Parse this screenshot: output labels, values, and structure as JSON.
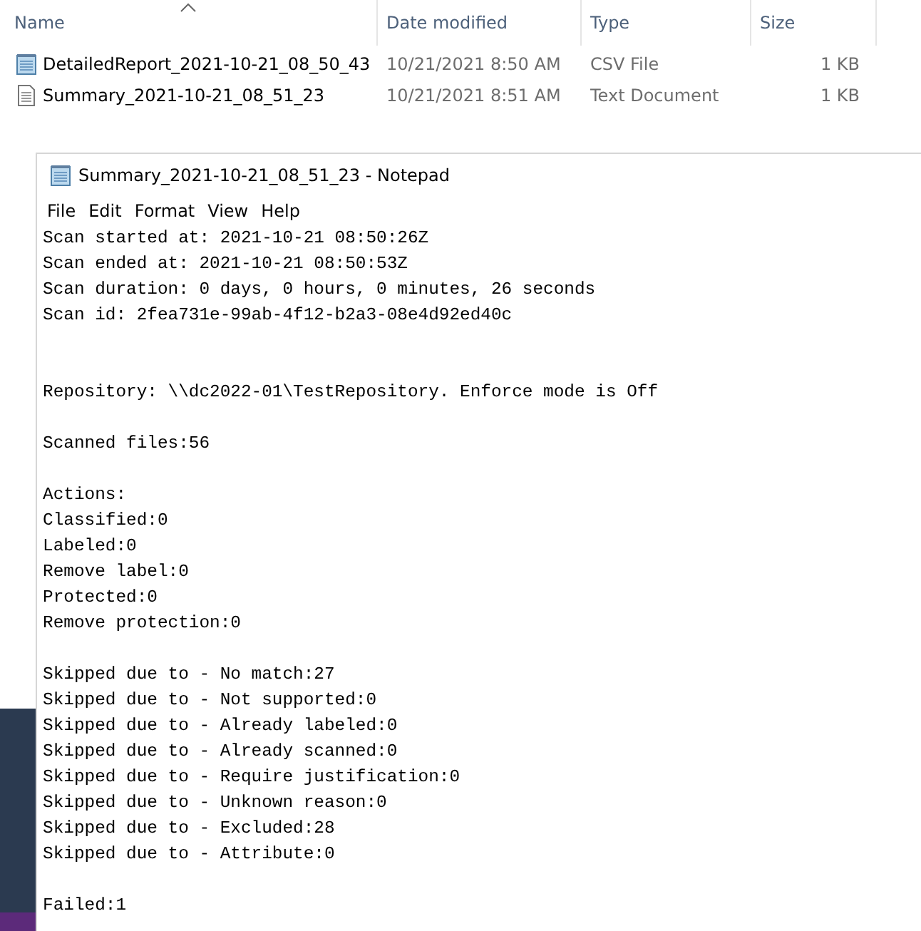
{
  "explorer": {
    "columns": [
      {
        "label": "Name",
        "sorted": true
      },
      {
        "label": "Date modified",
        "sorted": false
      },
      {
        "label": "Type",
        "sorted": false
      },
      {
        "label": "Size",
        "sorted": false
      }
    ],
    "files": [
      {
        "name": "DetailedReport_2021-10-21_08_50_43",
        "date": "10/21/2021 8:50 AM",
        "type": "CSV File",
        "size": "1 KB",
        "kind": "csv"
      },
      {
        "name": "Summary_2021-10-21_08_51_23",
        "date": "10/21/2021 8:51 AM",
        "type": "Text Document",
        "size": "1 KB",
        "kind": "text"
      }
    ]
  },
  "notepad": {
    "title": "Summary_2021-10-21_08_51_23 - Notepad",
    "menu": [
      "File",
      "Edit",
      "Format",
      "View",
      "Help"
    ],
    "paragraphs": [
      [
        "Scan started at: 2021-10-21 08:50:26Z",
        "Scan ended at: 2021-10-21 08:50:53Z",
        "Scan duration: 0 days, 0 hours, 0 minutes, 26 seconds",
        "Scan id: 2fea731e-99ab-4f12-b2a3-08e4d92ed40c"
      ],
      [
        "Repository: \\\\dc2022-01\\TestRepository. Enforce mode is Off"
      ],
      [
        "Scanned files:56"
      ],
      [
        "Actions:",
        "Classified:0",
        "Labeled:0",
        "Remove label:0",
        "Protected:0",
        "Remove protection:0"
      ],
      [
        "Skipped due to - No match:27",
        "Skipped due to - Not supported:0",
        "Skipped due to - Already labeled:0",
        "Skipped due to - Already scanned:0",
        "Skipped due to - Require justification:0",
        "Skipped due to - Unknown reason:0",
        "Skipped due to - Excluded:28",
        "Skipped due to - Attribute:0"
      ],
      [
        "Failed:1"
      ]
    ]
  }
}
